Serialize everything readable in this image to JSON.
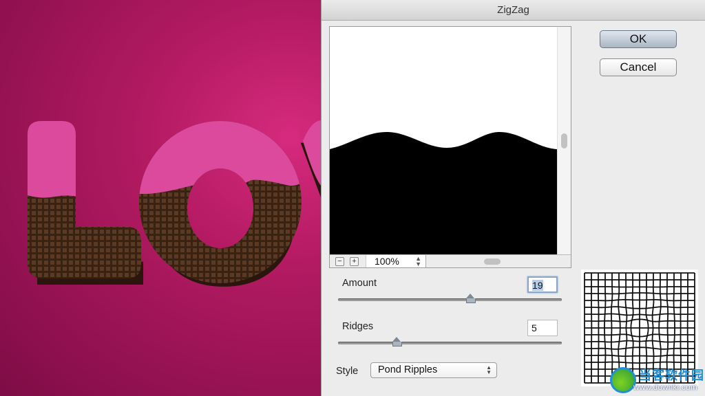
{
  "canvas": {
    "artwork_text": "LOVE"
  },
  "dialog": {
    "title": "ZigZag",
    "ok_label": "OK",
    "cancel_label": "Cancel",
    "preview": {
      "zoom_out": "−",
      "zoom_in": "+",
      "zoom_level": "100%"
    },
    "amount": {
      "label": "Amount",
      "value": "19",
      "fraction": 0.59
    },
    "ridges": {
      "label": "Ridges",
      "value": "5",
      "fraction": 0.26
    },
    "style": {
      "label": "Style",
      "selected": "Pond Ripples"
    }
  },
  "watermark": {
    "name": "当客软件园",
    "url": "www.downkr.com"
  },
  "colors": {
    "pink": "#dc4a9e",
    "chocolate": "#3e2415",
    "accent": "#8aa6c8"
  }
}
